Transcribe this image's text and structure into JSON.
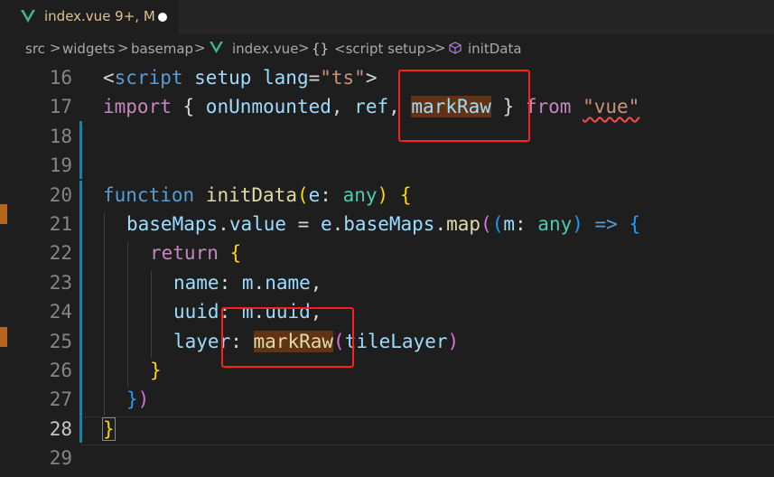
{
  "tab": {
    "title": "index.vue  9+, M",
    "icon": "vue-icon"
  },
  "breadcrumb": {
    "src": "src",
    "widgets": "widgets",
    "basemap": "basemap",
    "file": "index.vue",
    "braces": "{}",
    "script": "<script setup>",
    "symbol": "initData",
    "separator": ">"
  },
  "line_numbers": [
    "16",
    "17",
    "18",
    "19",
    "20",
    "21",
    "22",
    "23",
    "24",
    "25",
    "26",
    "27",
    "28",
    "29"
  ],
  "active_line": "28",
  "code": {
    "l16": {
      "lt": "<",
      "tag": "script",
      "a1": " setup",
      "a2": " lang",
      "eq": "=",
      "val": "\"ts\"",
      "gt": ">"
    },
    "l17": {
      "kw": "import",
      "ob": " { ",
      "i1": "onUnmounted",
      "c1": ", ",
      "i2": "ref",
      "c2": ", ",
      "i3": "markRaw",
      "cb": " } ",
      "from": "from",
      "sp": " ",
      "mod": "\"vue\""
    },
    "l20": {
      "kw": "function",
      "sp": " ",
      "fn": "initData",
      "op": "(",
      "p": "e",
      "colon": ": ",
      "t": "any",
      "cp": ")",
      "sp2": " ",
      "ob": "{"
    },
    "l21": {
      "obj": "baseMaps",
      "d1": ".",
      "prop": "value",
      "eq": " = ",
      "e": "e",
      "d2": ".",
      "bm": "baseMaps",
      "d3": ".",
      "map": "map",
      "p1": "(",
      "p2": "(",
      "m": "m",
      "colon": ": ",
      "t": "any",
      "p3": ")",
      "arrow": " => ",
      "ob": "{"
    },
    "l22": {
      "kw": "return",
      "sp": " ",
      "ob": "{"
    },
    "l23": {
      "k": "name",
      "colon": ": ",
      "m": "m",
      "d": ".",
      "v": "name",
      "c": ","
    },
    "l24": {
      "k": "uuid",
      "colon": ": ",
      "m": "m",
      "d": ".",
      "v": "uuid",
      "c": ","
    },
    "l25": {
      "k": "layer",
      "colon": ": ",
      "fn": "markRaw",
      "op": "(",
      "arg": "tileLayer",
      "cp": ")"
    },
    "l26": {
      "cb": "}"
    },
    "l27": {
      "cb": "}",
      "cp": ")"
    },
    "l28": {
      "cb": "}"
    }
  },
  "colors": {
    "annotation": "#ff1f1f",
    "highlight": "#613214",
    "modified_bar": "#1b81a8"
  }
}
